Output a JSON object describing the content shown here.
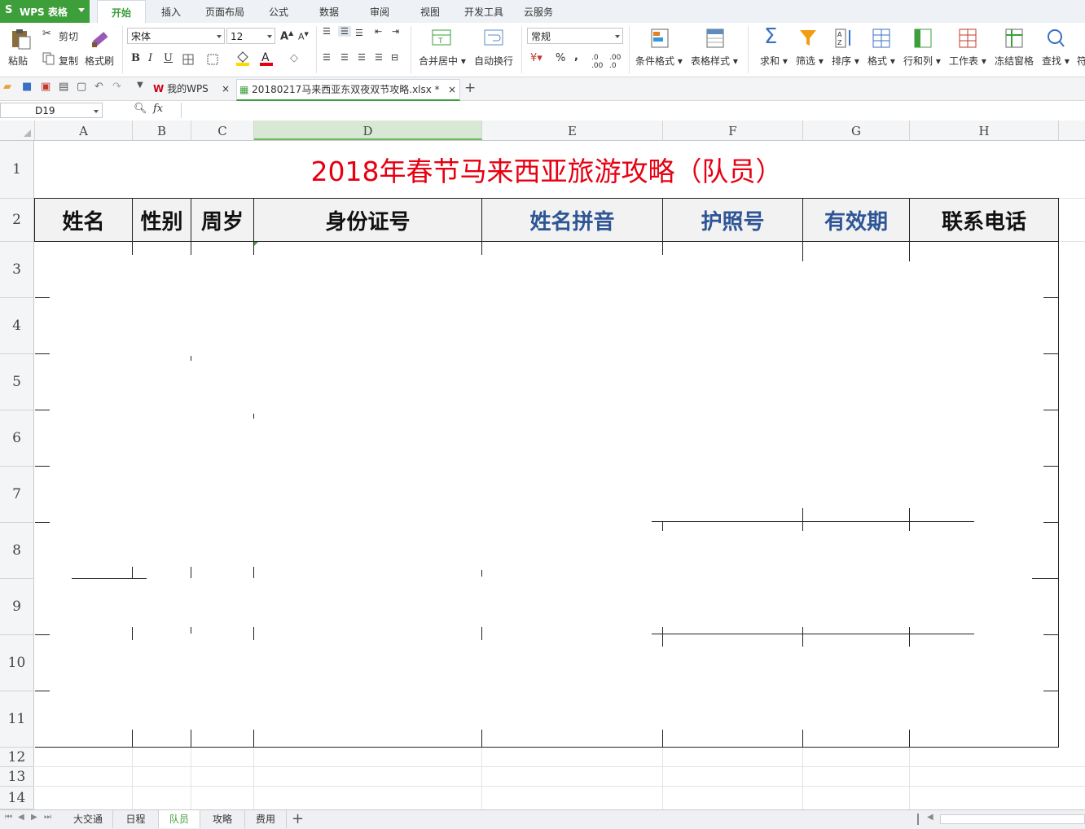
{
  "app": {
    "brand": "WPS 表格",
    "brand_glyph": "S"
  },
  "ribbon_tabs": [
    "开始",
    "插入",
    "页面布局",
    "公式",
    "数据",
    "审阅",
    "视图",
    "开发工具",
    "云服务"
  ],
  "ribbon": {
    "paste": "粘贴",
    "cut": "剪切",
    "copy": "复制",
    "format_painter": "格式刷",
    "font_name": "宋体",
    "font_size": "12",
    "merge_center": "合并居中",
    "wrap_text": "自动换行",
    "number_format": "常规",
    "percent": "%",
    "cond_format": "条件格式",
    "table_style": "表格样式",
    "sum": "求和",
    "filter": "筛选",
    "sort": "排序",
    "format": "格式",
    "row_col": "行和列",
    "worksheet": "工作表",
    "freeze": "冻结窗格",
    "find": "查找",
    "more": "符"
  },
  "doc_tabs": {
    "home": "我的WPS",
    "file": "20180217马来西亚东双夜双节攻略.xlsx *"
  },
  "formula_bar": {
    "cell_ref": "D19",
    "fx": "fx"
  },
  "columns": [
    "A",
    "B",
    "C",
    "D",
    "E",
    "F",
    "G",
    "H"
  ],
  "rows": [
    "1",
    "2",
    "3",
    "4",
    "5",
    "6",
    "7",
    "8",
    "9",
    "10",
    "11",
    "12",
    "13",
    "14"
  ],
  "sheet": {
    "title": "2018年春节马来西亚旅游攻略（队员）",
    "headers": [
      "姓名",
      "性别",
      "周岁",
      "身份证号",
      "姓名拼音",
      "护照号",
      "有效期",
      "联系电话"
    ]
  },
  "sheet_tabs": [
    "大交通",
    "日程",
    "队员",
    "攻略",
    "费用"
  ],
  "active_sheet": "队员",
  "colors": {
    "brand_green": "#3c9f3a",
    "title_red": "#e60012",
    "header_blue": "#2e5595"
  }
}
